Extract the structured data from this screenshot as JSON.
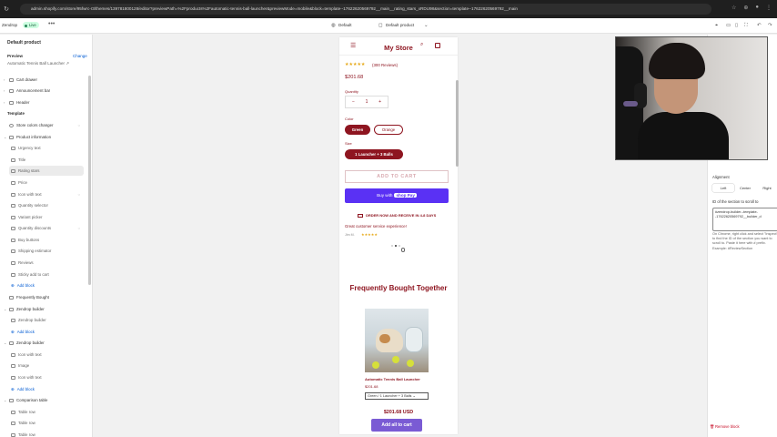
{
  "browser": {
    "url": "admin.shopify.com/store/95fwrc-r3/themes/139781800128/editor?previewPath=%2Fproducts%2Fautomatic-tennis-ball-launcher&previewMode=mobile&block=template--17622620569792__main__rating_stars_xRDU98&section=template--17622620569792__main"
  },
  "editor_bar": {
    "store_name": "Zendrop",
    "status": "Live",
    "more": "•••",
    "theme": "Default",
    "template": "Default product"
  },
  "sidebar": {
    "title": "Default product",
    "preview_label": "Preview",
    "change_label": "Change",
    "preview_product": "Automatic Tennis Ball Launcher",
    "template_heading": "Template",
    "header_items": [
      "Cart drawer",
      "Announcement bar",
      "Header"
    ],
    "items": [
      {
        "label": "Store colors changer",
        "level": 1
      },
      {
        "label": "Product information",
        "level": 1
      },
      {
        "label": "Urgency text",
        "level": 2
      },
      {
        "label": "Title",
        "level": 2
      },
      {
        "label": "Rating stars",
        "level": 2,
        "selected": true
      },
      {
        "label": "Price",
        "level": 2
      },
      {
        "label": "Icon with text",
        "level": 2
      },
      {
        "label": "Quantity selector",
        "level": 2
      },
      {
        "label": "Variant picker",
        "level": 2
      },
      {
        "label": "Quantity discounts",
        "level": 2
      },
      {
        "label": "Buy buttons",
        "level": 2
      },
      {
        "label": "Shipping estimator",
        "level": 2
      },
      {
        "label": "Reviews",
        "level": 2
      },
      {
        "label": "Sticky add to cart",
        "level": 2
      },
      {
        "label": "Add block",
        "level": 2,
        "add": true
      },
      {
        "label": "Frequently Bought",
        "level": 1
      },
      {
        "label": "Zendrop builder",
        "level": 1
      },
      {
        "label": "Zendrop builder",
        "level": 2
      },
      {
        "label": "Add block",
        "level": 2,
        "add": true
      },
      {
        "label": "Zendrop builder",
        "level": 1
      },
      {
        "label": "Icon with text",
        "level": 2
      },
      {
        "label": "Image",
        "level": 2
      },
      {
        "label": "Icon with text",
        "level": 2
      },
      {
        "label": "Add block",
        "level": 2,
        "add": true
      },
      {
        "label": "Comparison table",
        "level": 1
      },
      {
        "label": "Table row",
        "level": 2
      },
      {
        "label": "Table row",
        "level": 2
      },
      {
        "label": "Table row",
        "level": 2
      }
    ]
  },
  "preview": {
    "store_title": "My Store",
    "stars": "★★★★★",
    "reviews": "(300 Reviews)",
    "price": "$201.68",
    "quantity_label": "Quantity",
    "qty_minus": "−",
    "qty_value": "1",
    "qty_plus": "+",
    "color_label": "Color",
    "colors": [
      "Green",
      "Orange"
    ],
    "size_label": "Size",
    "size_value": "1 Launcher + 3 Balls",
    "add_to_cart": "ADD TO CART",
    "buy_with": "Buy with",
    "shop_pay": "shop Pay",
    "order_banner": "ORDER NOW AND RECEIVE IN 4-8 DAYS",
    "testimonial": "Great customer service experience!",
    "testimonial_author": "Jim M.",
    "testimonial_stars": "★★★★★",
    "fbt_title": "Frequently Bought Together",
    "fbt_product": "Automatic Tennis Ball Launcher",
    "fbt_price": "$201.68",
    "fbt_variant": "Green / 1 Launcher + 3 Balls",
    "fbt_total": "$201.68 USD",
    "fbt_button": "Add all to cart"
  },
  "right_panel": {
    "alignment_label": "Alignment",
    "alignment_options": [
      "Left",
      "Center",
      "Right"
    ],
    "alignment_selected": "Left",
    "scroll_label": "ID of the section to scroll to",
    "scroll_value": "#zendrop-builder--template--17622620569792__builder_d",
    "help_text": "On Chrome, right click and select \"Inspect\" to find the ID of the section you want to scroll to. Paste it here with # prefix. Example: #ReviewSection",
    "remove_block": "Remove block"
  },
  "colors": {
    "brand": "#8e1520",
    "shop_pay": "#5a31f4",
    "add_all": "#7a5bd4",
    "star": "#e6a817",
    "link": "#005bd3",
    "danger": "#c70a24"
  }
}
